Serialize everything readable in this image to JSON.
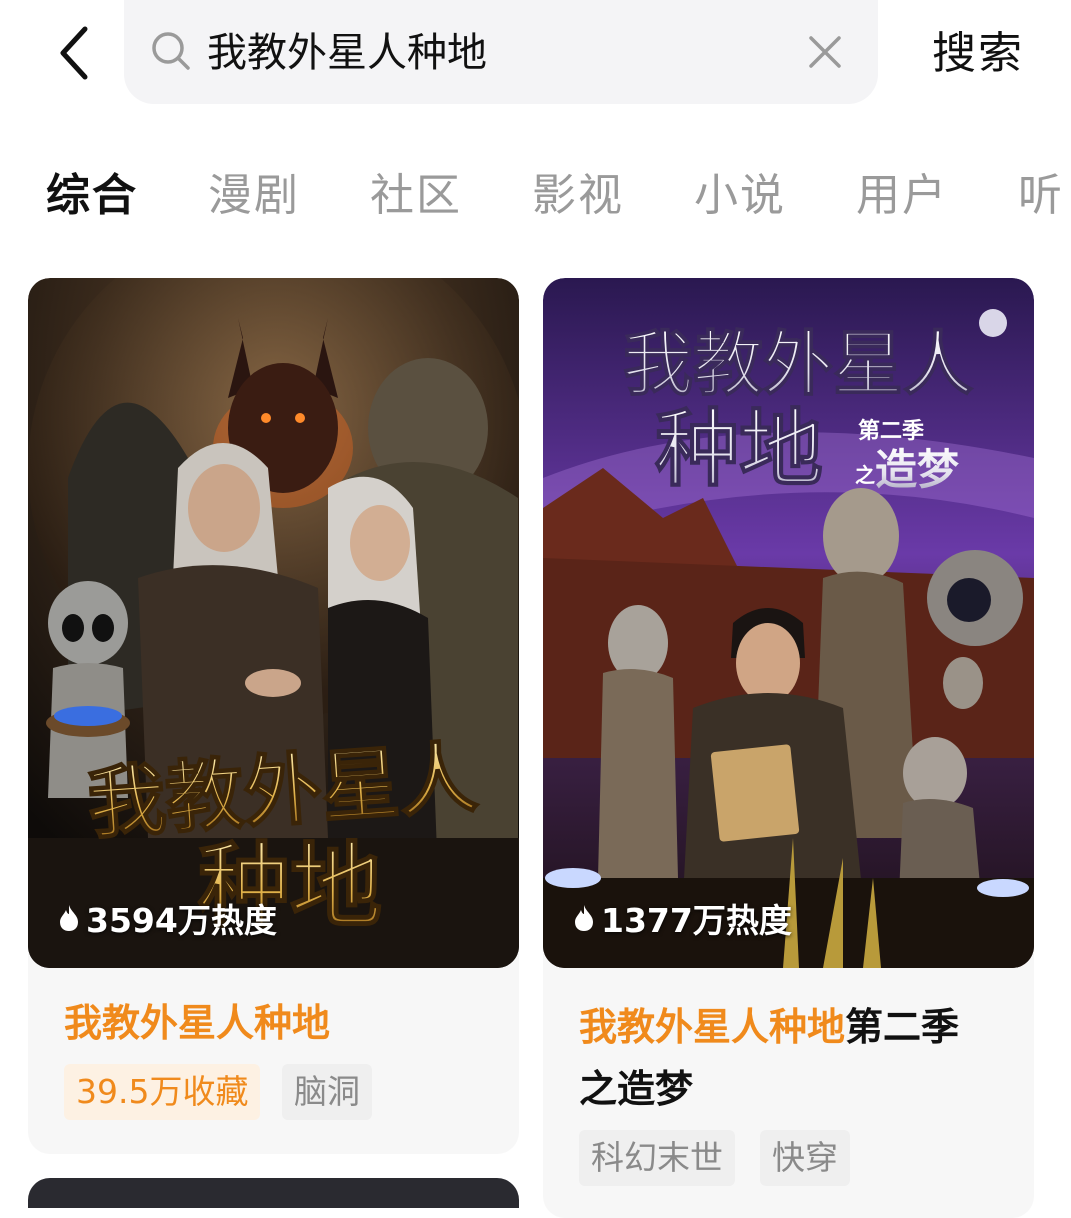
{
  "search": {
    "query": "我教外星人种地",
    "button_label": "搜索"
  },
  "tabs": [
    {
      "label": "综合",
      "active": true
    },
    {
      "label": "漫剧",
      "active": false
    },
    {
      "label": "社区",
      "active": false
    },
    {
      "label": "影视",
      "active": false
    },
    {
      "label": "小说",
      "active": false
    },
    {
      "label": "用户",
      "active": false
    },
    {
      "label": "听",
      "active": false
    }
  ],
  "results": [
    {
      "cover_title_line1": "我教外星人",
      "cover_title_line2": "种地",
      "heat": "3594万热度",
      "title_highlight": "我教外星人种地",
      "title_rest": "",
      "tags": [
        "39.5万收藏",
        "脑洞"
      ]
    },
    {
      "cover_title_line1": "我教外星人",
      "cover_title_line2": "种地",
      "cover_season": "第二季",
      "cover_zhi": "之",
      "cover_subtitle": "造梦",
      "heat": "1377万热度",
      "title_highlight": "我教外星人种地",
      "title_rest": "第二季",
      "title_line2": "之造梦",
      "tags": [
        "科幻末世",
        "快穿"
      ]
    }
  ],
  "colors": {
    "highlight": "#f08a1c",
    "tab_active": "#111111",
    "tab_inactive": "#9a9a9a",
    "search_bg": "#f4f4f6"
  }
}
